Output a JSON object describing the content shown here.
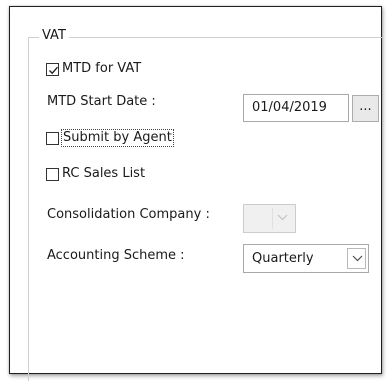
{
  "group": {
    "title": "VAT"
  },
  "mtd_for_vat": {
    "label": "MTD for VAT",
    "checked": true
  },
  "mtd_start_date": {
    "label": "MTD Start Date :",
    "value": "01/04/2019",
    "browse_label": "..."
  },
  "submit_by_agent": {
    "label": "Submit by Agent",
    "checked": false
  },
  "rc_sales_list": {
    "label": "RC Sales List",
    "checked": false
  },
  "consolidation_company": {
    "label": "Consolidation Company :",
    "value": "",
    "enabled": false
  },
  "accounting_scheme": {
    "label": "Accounting Scheme :",
    "value": "Quarterly"
  },
  "colors": {
    "panel_border": "#202020",
    "group_border": "#cfcfcf",
    "input_border": "#a9a9a9",
    "disabled_fill": "#f0f0f0"
  }
}
